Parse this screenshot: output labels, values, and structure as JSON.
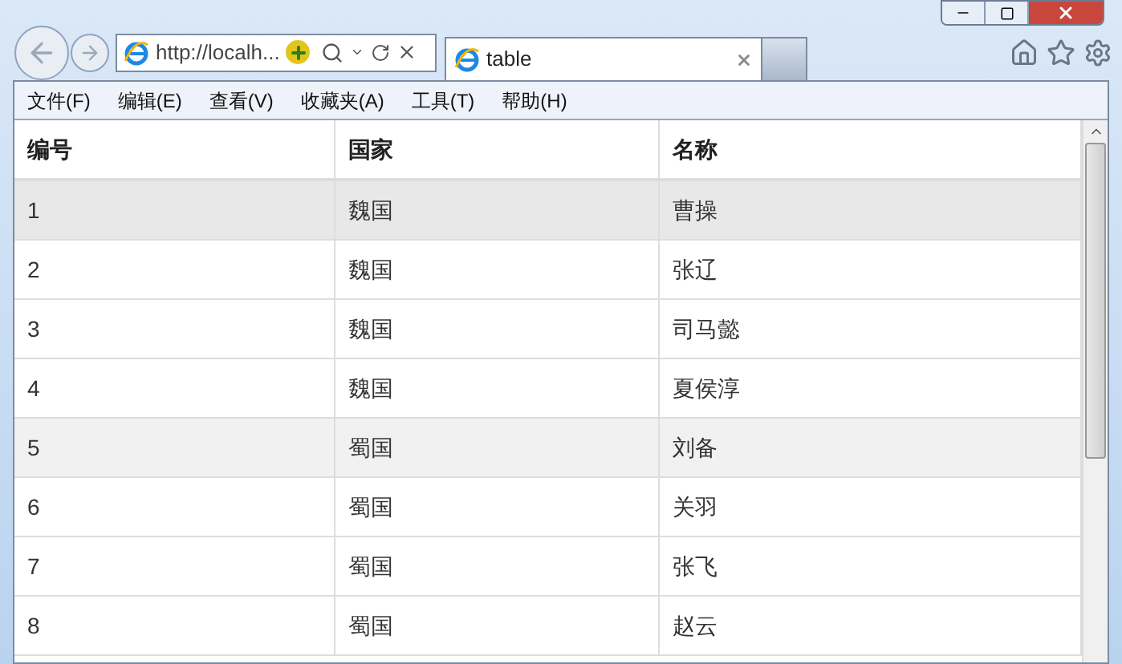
{
  "address_bar": {
    "value": "http://localh..."
  },
  "tabs": [
    {
      "label": "table",
      "selected": true
    }
  ],
  "menu": [
    "文件(F)",
    "编辑(E)",
    "查看(V)",
    "收藏夹(A)",
    "工具(T)",
    "帮助(H)"
  ],
  "table": {
    "columns": [
      "编号",
      "国家",
      "名称"
    ],
    "rows": [
      {
        "cells": [
          "1",
          "魏国",
          "曹操"
        ],
        "selected": true,
        "hovered": false
      },
      {
        "cells": [
          "2",
          "魏国",
          "张辽"
        ],
        "selected": false,
        "hovered": false
      },
      {
        "cells": [
          "3",
          "魏国",
          "司马懿"
        ],
        "selected": false,
        "hovered": false
      },
      {
        "cells": [
          "4",
          "魏国",
          "夏侯淳"
        ],
        "selected": false,
        "hovered": false
      },
      {
        "cells": [
          "5",
          "蜀国",
          "刘备"
        ],
        "selected": false,
        "hovered": true
      },
      {
        "cells": [
          "6",
          "蜀国",
          "关羽"
        ],
        "selected": false,
        "hovered": false
      },
      {
        "cells": [
          "7",
          "蜀国",
          "张飞"
        ],
        "selected": false,
        "hovered": false
      },
      {
        "cells": [
          "8",
          "蜀国",
          "赵云"
        ],
        "selected": false,
        "hovered": false
      }
    ]
  }
}
